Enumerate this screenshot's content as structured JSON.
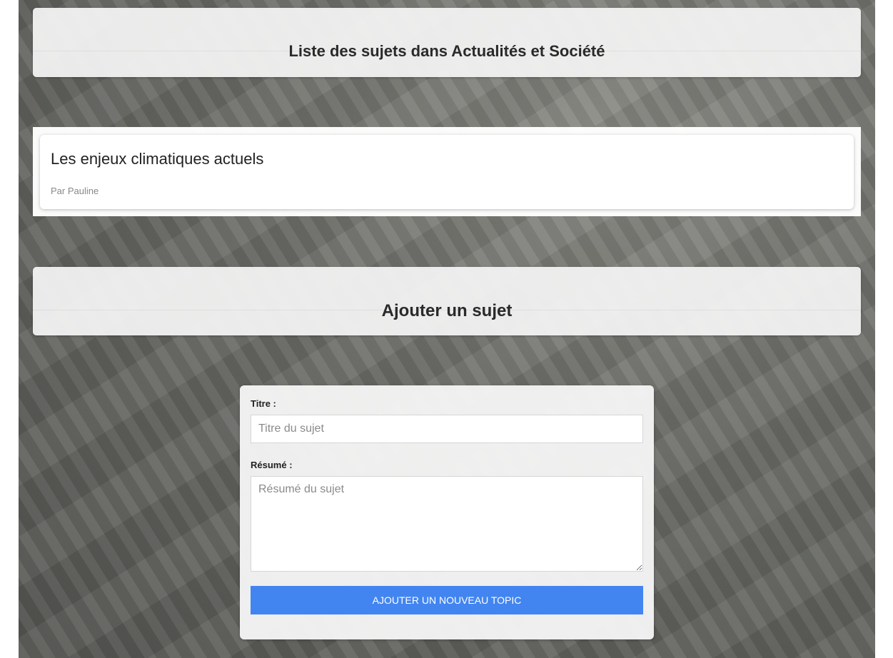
{
  "topics_header": {
    "title": "Liste des sujets dans Actualités et Société"
  },
  "topics": [
    {
      "title": "Les enjeux climatiques actuels",
      "author": "Par Pauline"
    }
  ],
  "add_header": {
    "title": "Ajouter un sujet"
  },
  "form": {
    "title_label": "Titre :",
    "title_placeholder": "Titre du sujet",
    "summary_label": "Résumé :",
    "summary_placeholder": "Résumé du sujet",
    "submit_label": "AJOUTER UN NOUVEAU TOPIC"
  },
  "colors": {
    "accent": "#4285f0"
  }
}
